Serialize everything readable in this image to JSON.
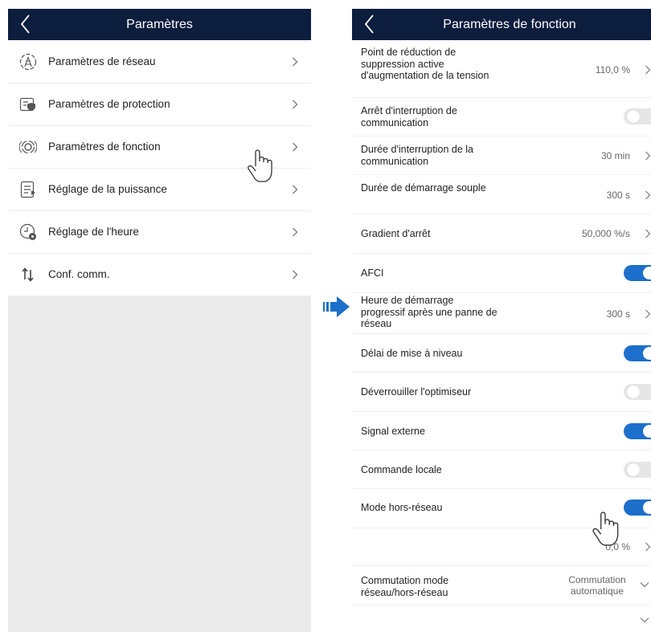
{
  "left": {
    "header": {
      "title": "Paramètres"
    },
    "items": [
      {
        "label": "Paramètres de réseau",
        "icon": "network-icon"
      },
      {
        "label": "Paramètres de protection",
        "icon": "protection-icon"
      },
      {
        "label": "Paramètres de fonction",
        "icon": "function-icon"
      },
      {
        "label": "Réglage de la puissance",
        "icon": "power-icon"
      },
      {
        "label": "Réglage de l'heure",
        "icon": "clock-icon"
      },
      {
        "label": "Conf. comm.",
        "icon": "comm-icon"
      }
    ]
  },
  "right": {
    "header": {
      "title": "Paramètres de fonction"
    },
    "rows": [
      {
        "label": "Point de réduction de suppression active d'augmentation de la tension",
        "value": "110,0 %"
      },
      {
        "label": "Arrêt d'interruption de communication",
        "toggle": false
      },
      {
        "label": "Durée d'interruption de la communication",
        "value": "30 min"
      },
      {
        "label": "Durée de démarrage souple",
        "value": "300 s"
      },
      {
        "label": "Gradient d'arrêt",
        "value": "50,000 %/s"
      },
      {
        "label": "AFCI",
        "toggle": true
      },
      {
        "label": "Heure de démarrage progressif après une panne de réseau",
        "value": "300 s"
      },
      {
        "label": "Délai de mise à niveau",
        "toggle": true
      },
      {
        "label": "Déverrouiller l'optimiseur",
        "toggle": false
      },
      {
        "label": "Signal externe",
        "toggle": true
      },
      {
        "label": "Commande locale",
        "toggle": false
      },
      {
        "label": "Mode hors-réseau",
        "toggle": true
      },
      {
        "label": "",
        "value": "0,0 %"
      },
      {
        "label": "Commutation mode réseau/hors-réseau",
        "value": "Commutation automatique"
      }
    ]
  },
  "colors": {
    "header_bg": "#0d1d3d",
    "toggle_on": "#1c6fcb",
    "toggle_off": "#e6e6e6",
    "arrow": "#1c6fcb"
  }
}
